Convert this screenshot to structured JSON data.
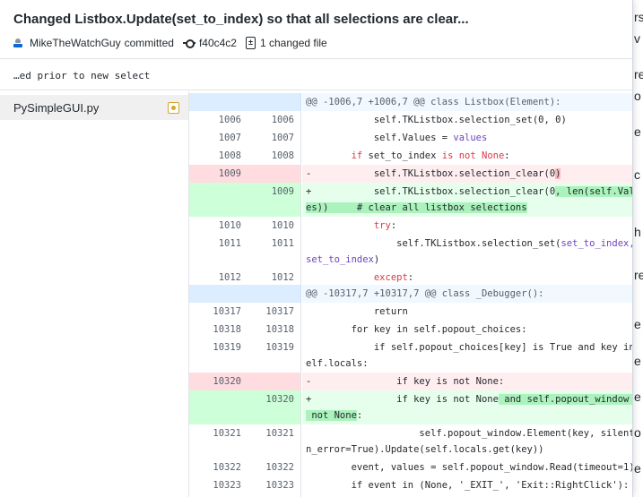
{
  "commit": {
    "title": "Changed Listbox.Update(set_to_index) so that all selections are clear...",
    "author": "MikeTheWatchGuy",
    "action": "committed",
    "sha": "f40c4c2",
    "changed_files": "1 changed file",
    "summary": "…ed prior to new select"
  },
  "files": [
    {
      "name": "PySimpleGUI.py",
      "status_icon": "modified-icon"
    }
  ],
  "hunks": [
    {
      "header": "@@ -1006,7 +1006,7 @@ class Listbox(Element):"
    },
    {
      "header": "@@ -10317,7 +10317,7 @@ class _Debugger():"
    }
  ],
  "lines": {
    "r1": {
      "old": "1006",
      "new": "1006",
      "code": "            self.TKListbox.selection_set(0, 0)"
    },
    "r2": {
      "old": "1007",
      "new": "1007",
      "a": "            self.Values = ",
      "b": "values"
    },
    "r3": {
      "old": "1008",
      "new": "1008",
      "a": "        ",
      "kw": "if",
      "b": " set_to_index ",
      "kw2": "is not None",
      "c": ":"
    },
    "r4": {
      "old": "1009",
      "new": "",
      "a": "-           self.TKListbox.selection_clear(0",
      "hl": ")"
    },
    "r5": {
      "old": "",
      "new": "1009",
      "a": "+           self.TKListbox.selection_clear(0",
      "hl": ", len(self.Valu",
      "b": "es))     # clear all listbox selections"
    },
    "r6": {
      "old": "1010",
      "new": "1010",
      "a": "            ",
      "kw": "try",
      "b": ":"
    },
    "r7": {
      "old": "1011",
      "new": "1011",
      "a": "                self.TKListbox.selection_set(",
      "b": "set_to_index,",
      "c": "set_to_index",
      "d": ")"
    },
    "r8": {
      "old": "1012",
      "new": "1012",
      "a": "            ",
      "kw": "except",
      "b": ":"
    },
    "r9": {
      "old": "10317",
      "new": "10317",
      "code": "            return"
    },
    "r10": {
      "old": "10318",
      "new": "10318",
      "code": "        for key in self.popout_choices:"
    },
    "r11": {
      "old": "10319",
      "new": "10319",
      "a": "            if self.popout_choices[key] is True and key in s",
      "b": "elf.locals:"
    },
    "r12": {
      "old": "10320",
      "new": "",
      "code": "-               if key is not None:"
    },
    "r13": {
      "old": "",
      "new": "10320",
      "a": "+               if key is not None",
      "hl": " and self.popout_window is",
      "hl2": " not None",
      "b": ":"
    },
    "r14": {
      "old": "10321",
      "new": "10321",
      "a": "                    self.popout_window.Element(key, silent_o",
      "b": "n_error=True).Update(self.locals.get(key))"
    },
    "r15": {
      "old": "10322",
      "new": "10322",
      "code": "        event, values = self.popout_window.Read(timeout=1)"
    },
    "r16": {
      "old": "10323",
      "new": "10323",
      "code": "        if event in (None, '_EXIT_', 'Exit::RightClick'):"
    }
  },
  "background": {
    "right_glyphs": [
      "rs",
      "v",
      "re",
      "o",
      "e",
      "c",
      "h",
      "re",
      "e",
      "e",
      "e",
      "o",
      "e"
    ]
  }
}
